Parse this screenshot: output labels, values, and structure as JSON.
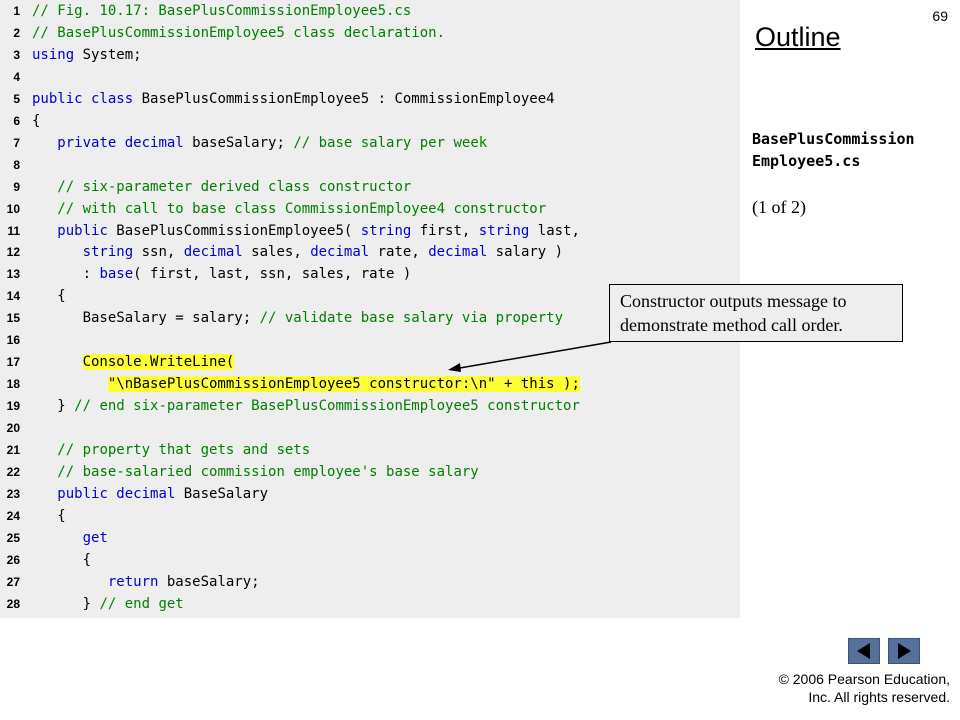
{
  "page_number": "69",
  "outline_title": "Outline",
  "file_name_line1": "BasePlusCommission",
  "file_name_line2": "Employee5.cs",
  "part_label": "(1 of 2)",
  "callout_text": "Constructor outputs message to demonstrate method call order.",
  "copyright_line1": "© 2006 Pearson Education,",
  "copyright_line2": "Inc.  All rights reserved.",
  "nav": {
    "prev_icon": "triangle-left-icon",
    "next_icon": "triangle-right-icon",
    "button_color": "#55709a"
  },
  "colors": {
    "keyword": "#0000cc",
    "comment": "#008000",
    "highlight": "#ffff33",
    "panel": "#eeeeee"
  },
  "code_lines": [
    {
      "n": "1",
      "segs": [
        {
          "c": "cm",
          "t": "// Fig. 10.17: BasePlusCommissionEmployee5.cs"
        }
      ]
    },
    {
      "n": "2",
      "segs": [
        {
          "c": "cm",
          "t": "// BasePlusCommissionEmployee5 class declaration."
        }
      ]
    },
    {
      "n": "3",
      "segs": [
        {
          "c": "kw",
          "t": "using"
        },
        {
          "t": " System;"
        }
      ]
    },
    {
      "n": "4",
      "segs": []
    },
    {
      "n": "5",
      "segs": [
        {
          "c": "kw",
          "t": "public class"
        },
        {
          "t": " BasePlusCommissionEmployee5 : CommissionEmployee4"
        }
      ]
    },
    {
      "n": "6",
      "segs": [
        {
          "t": "{"
        }
      ]
    },
    {
      "n": "7",
      "segs": [
        {
          "t": "   "
        },
        {
          "c": "kw",
          "t": "private decimal"
        },
        {
          "t": " baseSalary; "
        },
        {
          "c": "cm",
          "t": "// base salary per week"
        }
      ]
    },
    {
      "n": "8",
      "segs": []
    },
    {
      "n": "9",
      "segs": [
        {
          "t": "   "
        },
        {
          "c": "cm",
          "t": "// six-parameter derived class constructor"
        }
      ]
    },
    {
      "n": "10",
      "segs": [
        {
          "t": "   "
        },
        {
          "c": "cm",
          "t": "// with call to base class CommissionEmployee4 constructor"
        }
      ]
    },
    {
      "n": "11",
      "segs": [
        {
          "t": "   "
        },
        {
          "c": "kw",
          "t": "public"
        },
        {
          "t": " BasePlusCommissionEmployee5( "
        },
        {
          "c": "kw",
          "t": "string"
        },
        {
          "t": " first, "
        },
        {
          "c": "kw",
          "t": "string"
        },
        {
          "t": " last,"
        }
      ]
    },
    {
      "n": "12",
      "segs": [
        {
          "t": "      "
        },
        {
          "c": "kw",
          "t": "string"
        },
        {
          "t": " ssn, "
        },
        {
          "c": "kw",
          "t": "decimal"
        },
        {
          "t": " sales, "
        },
        {
          "c": "kw",
          "t": "decimal"
        },
        {
          "t": " rate, "
        },
        {
          "c": "kw",
          "t": "decimal"
        },
        {
          "t": " salary )"
        }
      ]
    },
    {
      "n": "13",
      "segs": [
        {
          "t": "      : "
        },
        {
          "c": "kw",
          "t": "base"
        },
        {
          "t": "( first, last, ssn, sales, rate )"
        }
      ]
    },
    {
      "n": "14",
      "segs": [
        {
          "t": "   {"
        }
      ]
    },
    {
      "n": "15",
      "segs": [
        {
          "t": "      BaseSalary = salary; "
        },
        {
          "c": "cm",
          "t": "// validate base salary via property"
        }
      ]
    },
    {
      "n": "16",
      "segs": []
    },
    {
      "n": "17",
      "segs": [
        {
          "t": "      "
        },
        {
          "c": "hl",
          "t": "Console.WriteLine("
        }
      ]
    },
    {
      "n": "18",
      "segs": [
        {
          "t": "         "
        },
        {
          "c": "hl",
          "t": "\"\\nBasePlusCommissionEmployee5 constructor:\\n\" + this );"
        }
      ]
    },
    {
      "n": "19",
      "segs": [
        {
          "t": "   } "
        },
        {
          "c": "cm",
          "t": "// end six-parameter BasePlusCommissionEmployee5 constructor"
        }
      ]
    },
    {
      "n": "20",
      "segs": []
    },
    {
      "n": "21",
      "segs": [
        {
          "t": "   "
        },
        {
          "c": "cm",
          "t": "// property that gets and sets"
        }
      ]
    },
    {
      "n": "22",
      "segs": [
        {
          "t": "   "
        },
        {
          "c": "cm",
          "t": "// base-salaried commission employee's base salary"
        }
      ]
    },
    {
      "n": "23",
      "segs": [
        {
          "t": "   "
        },
        {
          "c": "kw",
          "t": "public decimal"
        },
        {
          "t": " BaseSalary"
        }
      ]
    },
    {
      "n": "24",
      "segs": [
        {
          "t": "   {"
        }
      ]
    },
    {
      "n": "25",
      "segs": [
        {
          "t": "      "
        },
        {
          "c": "kw",
          "t": "get"
        }
      ]
    },
    {
      "n": "26",
      "segs": [
        {
          "t": "      {"
        }
      ]
    },
    {
      "n": "27",
      "segs": [
        {
          "t": "         "
        },
        {
          "c": "kw",
          "t": "return"
        },
        {
          "t": " baseSalary;"
        }
      ]
    },
    {
      "n": "28",
      "segs": [
        {
          "t": "      } "
        },
        {
          "c": "cm",
          "t": "// end get"
        }
      ]
    }
  ]
}
